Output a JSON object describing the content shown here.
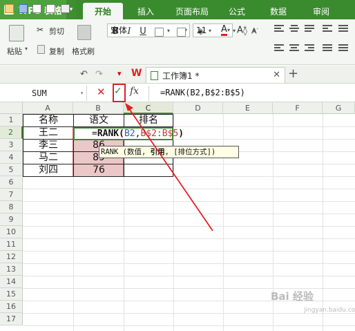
{
  "app": {
    "name": "WPS 表格",
    "logo": "S"
  },
  "tabs": [
    {
      "label": "开始",
      "active": true
    },
    {
      "label": "插入"
    },
    {
      "label": "页面布局"
    },
    {
      "label": "公式"
    },
    {
      "label": "数据"
    },
    {
      "label": "审阅"
    }
  ],
  "ribbon": {
    "paste": "粘贴",
    "cut": "剪切",
    "copy": "复制",
    "format_painter": "格式刷",
    "font_name": "宋体",
    "font_size": "11",
    "bold": "B",
    "italic": "I",
    "underline": "U"
  },
  "document_tab": {
    "title": "工作簿1 *"
  },
  "formula_bar": {
    "name_box": "SUM",
    "formula": "=RANK(B2,B$2:B$5)"
  },
  "columns": [
    "A",
    "B",
    "C",
    "D",
    "E",
    "F",
    "G"
  ],
  "rows": [
    "1",
    "2",
    "3",
    "4",
    "5",
    "6",
    "7",
    "8",
    "9",
    "10",
    "11",
    "12",
    "13",
    "14",
    "15",
    "16",
    "17"
  ],
  "cells": {
    "A1": "名称",
    "B1": "语文",
    "C1": "排名",
    "A2": "王二",
    "A3": "李三",
    "B3": "86",
    "A4": "马二",
    "B4": "89",
    "A5": "刘四",
    "B5": "76"
  },
  "edit_cell": {
    "prefix": "=",
    "func": "RANK",
    "open": "(",
    "arg1": "B2",
    "comma": ",",
    "arg2": "B$2:B$5",
    "close": ")"
  },
  "tooltip": {
    "func": "RANK",
    "open": " (",
    "p1": "数值",
    "sep1": ", ",
    "p2": "引用",
    "sep2": ", ",
    "p3": "[排位方式]",
    "close": ")"
  },
  "watermark": {
    "brand": "Bai 经验",
    "sub": "jingyan.baidu.com"
  },
  "colors": {
    "accent": "#3a8a2e",
    "annotation": "#e02020"
  }
}
